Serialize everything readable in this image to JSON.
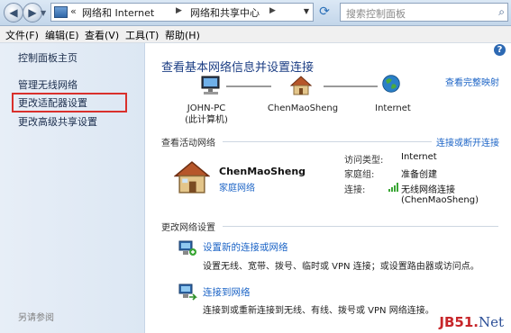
{
  "address": {
    "chevrons": "«",
    "segment1": "网络和 Internet",
    "separator": "▶",
    "segment2": "网络和共享中心",
    "search_placeholder": "搜索控制面板"
  },
  "menu": [
    "文件(F)",
    "编辑(E)",
    "查看(V)",
    "工具(T)",
    "帮助(H)"
  ],
  "sidebar": {
    "items": [
      {
        "label": "控制面板主页"
      },
      {
        "label": "管理无线网络"
      },
      {
        "label": "更改适配器设置"
      },
      {
        "label": "更改高级共享设置"
      }
    ],
    "footer": "另请参阅"
  },
  "main": {
    "title": "查看基本网络信息并设置连接",
    "see_full_map": "查看完整映射",
    "nodes": {
      "computer": {
        "name": "JOHN-PC",
        "sub": "(此计算机)"
      },
      "network": {
        "name": "ChenMaoSheng"
      },
      "internet": {
        "name": "Internet"
      }
    },
    "active_section": {
      "label": "查看活动网络",
      "connect_link": "连接或断开连接",
      "network_name": "ChenMaoSheng",
      "network_type": "家庭网络",
      "access_type_label": "访问类型:",
      "access_type_value": "Internet",
      "homegroup_label": "家庭组:",
      "homegroup_value": "准备创建",
      "connection_label": "连接:",
      "connection_value": "无线网络连接",
      "connection_sub": "(ChenMaoSheng)"
    },
    "change_section": {
      "label": "更改网络设置",
      "tasks": [
        {
          "title": "设置新的连接或网络",
          "desc": "设置无线、宽带、拨号、临时或 VPN 连接；或设置路由器或访问点。"
        },
        {
          "title": "连接到网络",
          "desc": "连接到或重新连接到无线、有线、拨号或 VPN 网络连接。"
        }
      ]
    }
  },
  "watermark": {
    "left": "JB51",
    "dot": ".",
    "right": "Net"
  },
  "colors": {
    "link": "#1c64c6",
    "title": "#1c3e84",
    "highlight_box": "#d9302c"
  }
}
